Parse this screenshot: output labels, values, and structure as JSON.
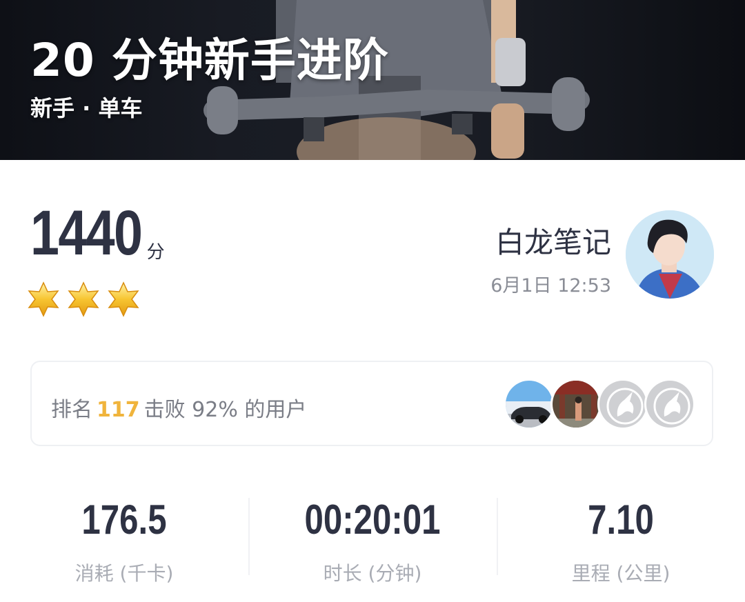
{
  "hero": {
    "title": "20 分钟新手进阶",
    "subtitle": "新手 · 单车"
  },
  "score": {
    "value": "1440",
    "unit": "分",
    "stars": 3
  },
  "user": {
    "name": "白龙笔记",
    "time": "6月1日 12:53"
  },
  "ranking": {
    "prefix": "排名",
    "rank": "117",
    "suffix": "击败 92% 的用户"
  },
  "stats": [
    {
      "value": "176.5",
      "label": "消耗 (千卡)"
    },
    {
      "value": "00:20:01",
      "label": "时长 (分钟)"
    },
    {
      "value": "7.10",
      "label": "里程 (公里)"
    }
  ],
  "colors": {
    "accent": "#f0b43c",
    "text_dark": "#2e3243",
    "text_muted": "#a9acb4"
  }
}
